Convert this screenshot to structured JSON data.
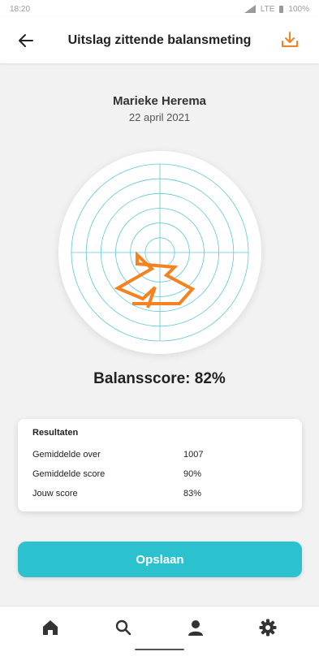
{
  "status_bar": {
    "time": "18:20",
    "network": "LTE",
    "battery": "100%"
  },
  "header": {
    "title": "Uitslag zittende balansmeting",
    "accent": "#f5821f"
  },
  "person": {
    "name": "Marieke Herema",
    "date": "22 april 2021"
  },
  "chart_data": {
    "type": "radar-polar",
    "rings": 6,
    "grid_color": "#5ec8d6",
    "line_color": "#f5821f",
    "path_points": [
      [
        5,
        24
      ],
      [
        30,
        22
      ],
      [
        17,
        12
      ],
      [
        32,
        23
      ],
      [
        28,
        6
      ],
      [
        22,
        0
      ],
      [
        -15,
        9
      ],
      [
        -7,
        15
      ],
      [
        7,
        3
      ],
      [
        24,
        25
      ],
      [
        40,
        22
      ],
      [
        -4,
        18
      ]
    ]
  },
  "score": {
    "label": "Balansscore: 82%"
  },
  "results": {
    "title": "Resultaten",
    "rows": [
      {
        "label": "Gemiddelde over",
        "value": "1007"
      },
      {
        "label": "Gemiddelde score",
        "value": "90%"
      },
      {
        "label": "Jouw score",
        "value": "83%"
      }
    ]
  },
  "save_button": {
    "label": "Opslaan",
    "color": "#2bc1cf"
  },
  "nav": {
    "items": [
      "home-icon",
      "search-icon",
      "profile-icon",
      "settings-icon"
    ]
  }
}
